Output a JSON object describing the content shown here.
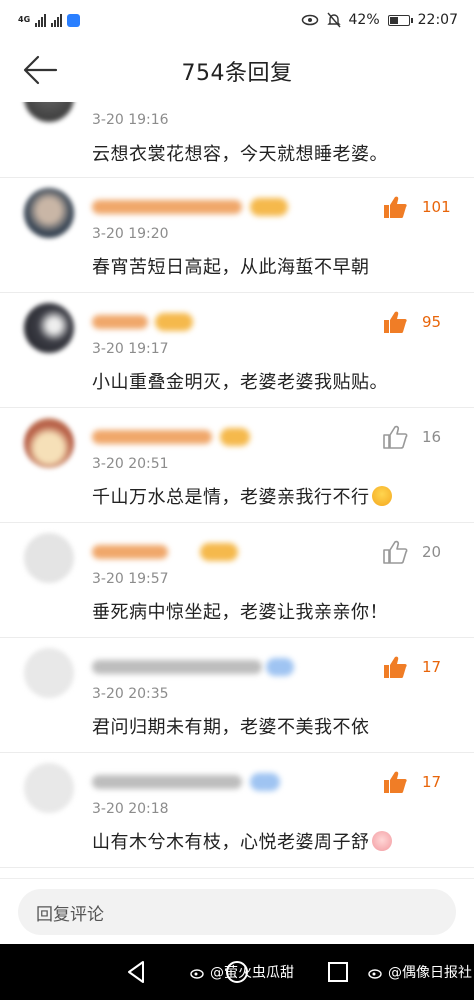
{
  "status_bar": {
    "network": "4G",
    "battery": "42%",
    "time": "22:07"
  },
  "header": {
    "title": "754条回复"
  },
  "comments": [
    {
      "time": "3-20 19:16",
      "text": "云想衣裳花想容，今天就想睡老婆。",
      "likes": ""
    },
    {
      "time": "3-20 19:20",
      "text": "春宵苦短日高起，从此海蜇不早朝",
      "likes": "101"
    },
    {
      "time": "3-20 19:17",
      "text": "小山重叠金明灭，老婆老婆我贴贴。",
      "likes": "95"
    },
    {
      "time": "3-20 20:51",
      "text": "千山万水总是情，老婆亲我行不行",
      "likes": "16"
    },
    {
      "time": "3-20 19:57",
      "text": "垂死病中惊坐起，老婆让我亲亲你！",
      "likes": "20"
    },
    {
      "time": "3-20 20:35",
      "text": "君问归期未有期，老婆不美我不依",
      "likes": "17"
    },
    {
      "time": "3-20 20:18",
      "text": "山有木兮木有枝，心悦老婆周子舒",
      "likes": "17"
    }
  ],
  "input": {
    "placeholder": "回复评论"
  },
  "watermarks": {
    "left": "@萤火虫瓜甜",
    "right": "@偶像日报社"
  },
  "colors": {
    "accent": "#e8650a",
    "muted": "#8c8c8c"
  }
}
